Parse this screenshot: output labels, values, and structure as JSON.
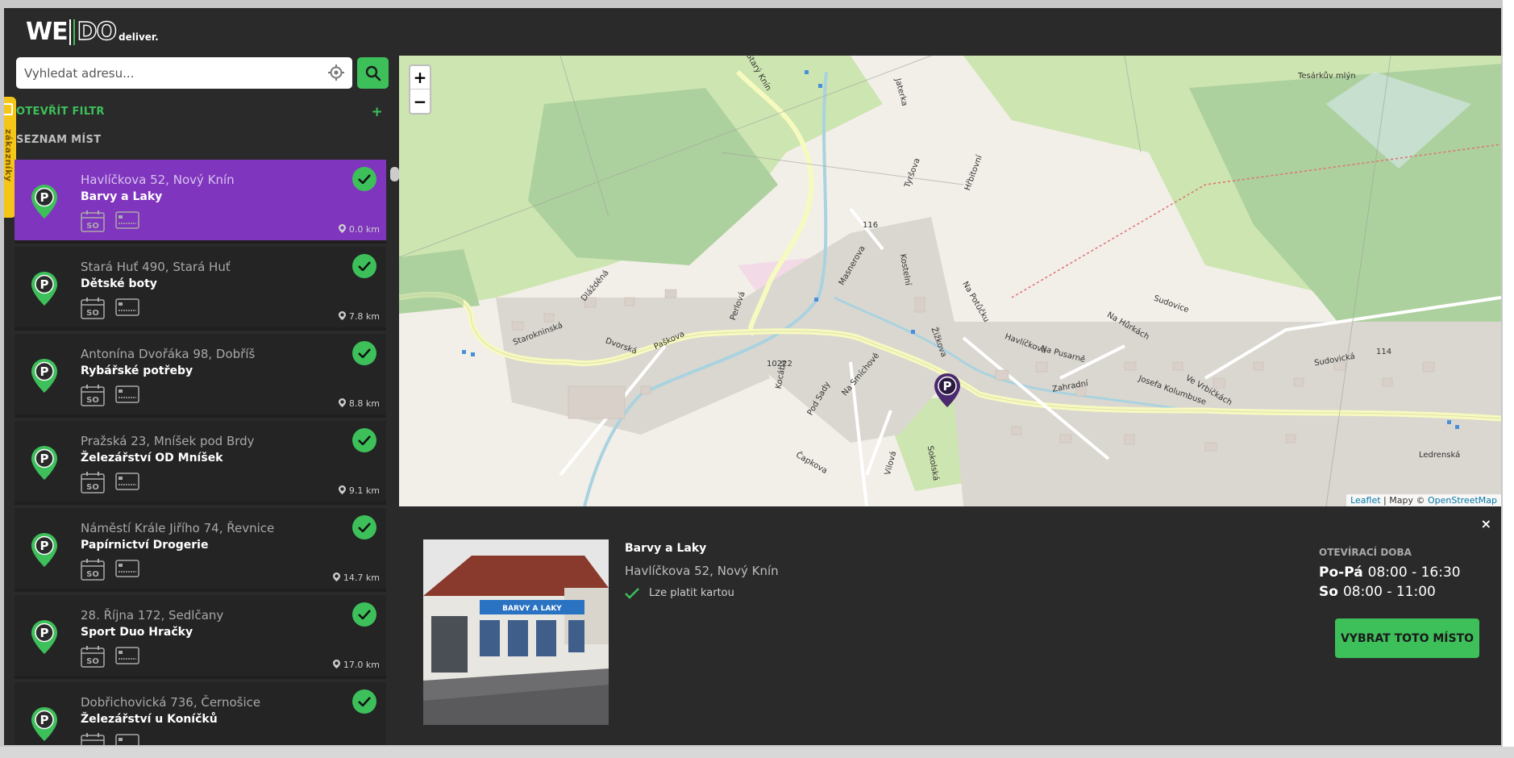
{
  "logo": {
    "we": "WE",
    "do": "DO",
    "deliver": "deliver."
  },
  "search": {
    "placeholder": "Vyhledat adresu..."
  },
  "filter": {
    "label": "OTEVŘÍT FILTR",
    "plus": "+"
  },
  "list_title": "SEZNAM MÍST",
  "side_tab": {
    "label": "Ověřeno zákazníky"
  },
  "items": [
    {
      "address": "Havlíčkova 52, Nový Knín",
      "name": "Barvy a Laky",
      "distance": "0.0 km",
      "active": true
    },
    {
      "address": "Stará Huť 490, Stará Huť",
      "name": "Dětské boty",
      "distance": "7.8 km",
      "active": false
    },
    {
      "address": "Antonína Dvořáka 98, Dobříš",
      "name": "Rybářské potřeby",
      "distance": "8.8 km",
      "active": false
    },
    {
      "address": "Pražská 23, Mníšek pod Brdy",
      "name": "Železářství OD Mníšek",
      "distance": "9.1 km",
      "active": false
    },
    {
      "address": "Náměstí Krále Jiřího 74, Řevnice",
      "name": "Papírnictví Drogerie",
      "distance": "14.7 km",
      "active": false
    },
    {
      "address": "28. Října 172, Sedlčany",
      "name": "Sport Duo Hračky",
      "distance": "17.0 km",
      "active": false
    },
    {
      "address": "Dobřichovická 736, Černošice",
      "name": "Železářství u Koníčků",
      "distance": "",
      "active": false
    }
  ],
  "cal_label": "SO",
  "map": {
    "zoom_in": "+",
    "zoom_out": "−",
    "attribution": {
      "leaflet": "Leaflet",
      "sep": " | Mapy © ",
      "osm": "OpenStreetMap"
    },
    "labels": [
      "Tesárkův mlýn",
      "Starý Knín",
      "Jaterka",
      "Tyršova",
      "Hřbitovní",
      "116",
      "Masnerova",
      "Kostelní",
      "Na Potůčku",
      "Sudovice",
      "Na Hůrkách",
      "114",
      "Sudovická",
      "Havlíčkova",
      "Na Pusarně",
      "Zahradní",
      "Žižkova",
      "Paškova",
      "Starokninská",
      "Dlážděná",
      "Dvorská",
      "Na Smíchově",
      "10222",
      "Pod Sady",
      "Josefa Kolumbuse",
      "Ve Vrbičkách",
      "Ledrenská",
      "Čapkova",
      "Vilová",
      "Sokolská",
      "Kocába",
      "Perlová"
    ]
  },
  "detail": {
    "name": "Barvy a Laky",
    "address": "Havlíčkova 52, Nový Knín",
    "card": "Lze platit kartou",
    "close": "×",
    "hours_title": "OTEVÍRACÍ DOBA",
    "hours": [
      {
        "day": "Po-Pá",
        "time": "08:00 - 16:30"
      },
      {
        "day": "So",
        "time": "08:00 - 11:00"
      }
    ],
    "select_label": "VYBRAT TOTO MÍSTO",
    "photo_sign": "BARVY A LAKY"
  },
  "colors": {
    "accent": "#3dbf5a",
    "active": "#8035be",
    "panel": "#2a2a2a"
  }
}
